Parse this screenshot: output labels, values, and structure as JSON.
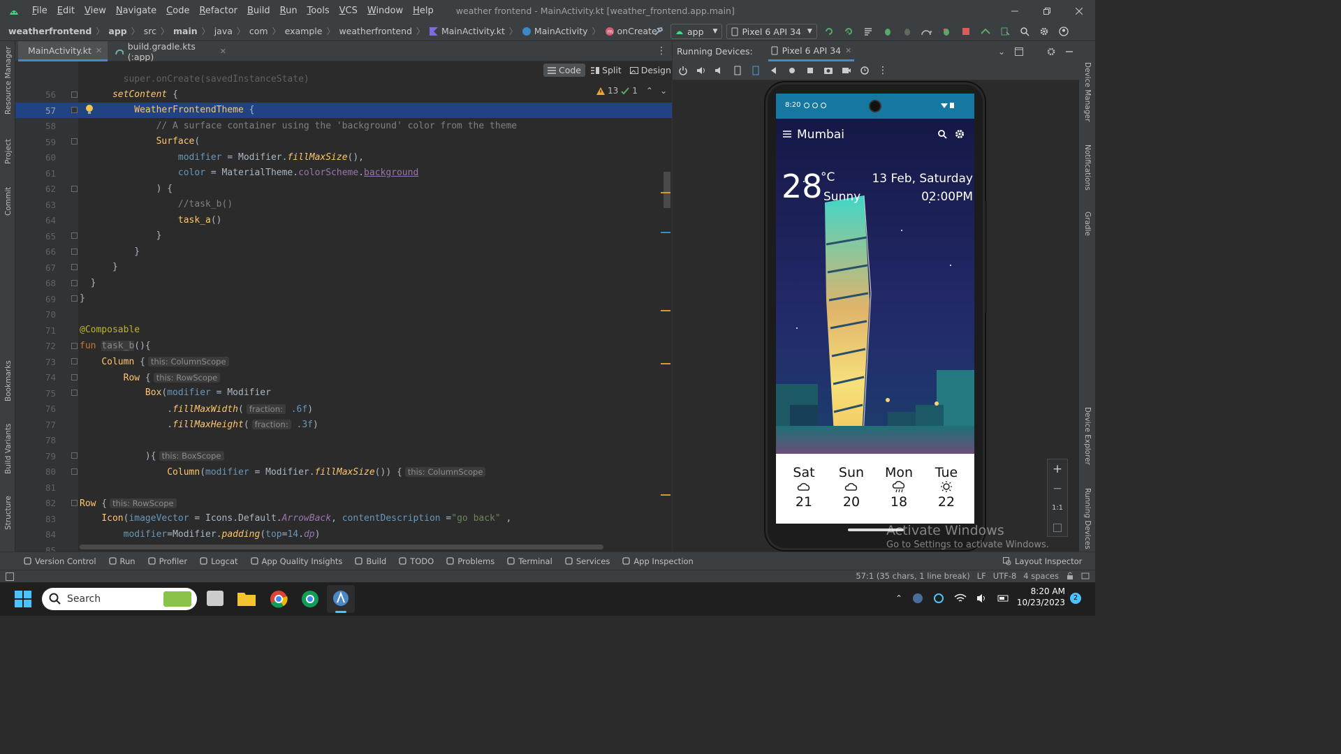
{
  "title_bar": {
    "menu": [
      "File",
      "Edit",
      "View",
      "Navigate",
      "Code",
      "Refactor",
      "Build",
      "Run",
      "Tools",
      "VCS",
      "Window",
      "Help"
    ],
    "window_title": "weather frontend - MainActivity.kt [weather_frontend.app.main]"
  },
  "breadcrumb": [
    "weatherfrontend",
    "app",
    "src",
    "main",
    "java",
    "com",
    "example",
    "weatherfrontend",
    "MainActivity.kt",
    "MainActivity",
    "onCreate"
  ],
  "toolbar": {
    "run_config": "app",
    "device": "Pixel 6 API 34"
  },
  "left_strip": [
    "Resource Manager",
    "Project",
    "Commit",
    "Bookmarks",
    "Build Variants",
    "Structure"
  ],
  "right_strip": [
    "Device Manager",
    "Notifications",
    "Gradle",
    "Device Explorer",
    "Running Devices"
  ],
  "editor_tabs": [
    {
      "label": "MainActivity.kt",
      "active": true
    },
    {
      "label": "build.gradle.kts (:app)",
      "active": false
    }
  ],
  "view_modes": [
    "Code",
    "Split",
    "Design"
  ],
  "inspections": {
    "warnings": "13",
    "weak_warnings": "1"
  },
  "code": {
    "partial_first_line": "        super.onCreate(savedInstanceState)",
    "lines": [
      {
        "n": "56"
      },
      {
        "n": "57"
      },
      {
        "n": "58"
      },
      {
        "n": "59"
      },
      {
        "n": "60"
      },
      {
        "n": "61"
      },
      {
        "n": "62"
      },
      {
        "n": "63"
      },
      {
        "n": "64"
      },
      {
        "n": "65"
      },
      {
        "n": "66"
      },
      {
        "n": "67"
      },
      {
        "n": "68"
      },
      {
        "n": "69"
      },
      {
        "n": "70"
      },
      {
        "n": "71"
      },
      {
        "n": "72"
      },
      {
        "n": "73"
      },
      {
        "n": "74"
      },
      {
        "n": "75"
      },
      {
        "n": "76"
      },
      {
        "n": "77"
      },
      {
        "n": "78"
      },
      {
        "n": "79"
      },
      {
        "n": "80"
      },
      {
        "n": "81"
      },
      {
        "n": "82"
      },
      {
        "n": "83"
      },
      {
        "n": "84"
      },
      {
        "n": "85"
      }
    ],
    "current_line": "57"
  },
  "running_devices": {
    "label": "Running Devices:",
    "tab": "Pixel 6 API 34"
  },
  "phone": {
    "status_time": "8:20",
    "city": "Mumbai",
    "temperature": "28",
    "unit": "°C",
    "condition": "Sunny",
    "date": "13 Feb, Saturday",
    "time": "02:00PM",
    "forecast": [
      {
        "day": "Sat",
        "icon": "cloud-icon",
        "temp": "21"
      },
      {
        "day": "Sun",
        "icon": "cloud-icon",
        "temp": "20"
      },
      {
        "day": "Mon",
        "icon": "cloud-rain-icon",
        "temp": "18"
      },
      {
        "day": "Tue",
        "icon": "sun-icon",
        "temp": "22"
      }
    ]
  },
  "zoom_controls": [
    "+",
    "−",
    "1:1"
  ],
  "watermark": {
    "title": "Activate Windows",
    "subtitle": "Go to Settings to activate Windows."
  },
  "tool_windows": [
    "Version Control",
    "Run",
    "Profiler",
    "Logcat",
    "App Quality Insights",
    "Build",
    "TODO",
    "Problems",
    "Terminal",
    "Services",
    "App Inspection"
  ],
  "layout_inspector": "Layout Inspector",
  "status": {
    "position": "57:1 (35 chars, 1 line break)",
    "line_sep": "LF",
    "encoding": "UTF-8",
    "indent": "4 spaces"
  },
  "taskbar": {
    "search_placeholder": "Search",
    "time": "8:20 AM",
    "date": "10/23/2023",
    "notification_count": "2"
  }
}
